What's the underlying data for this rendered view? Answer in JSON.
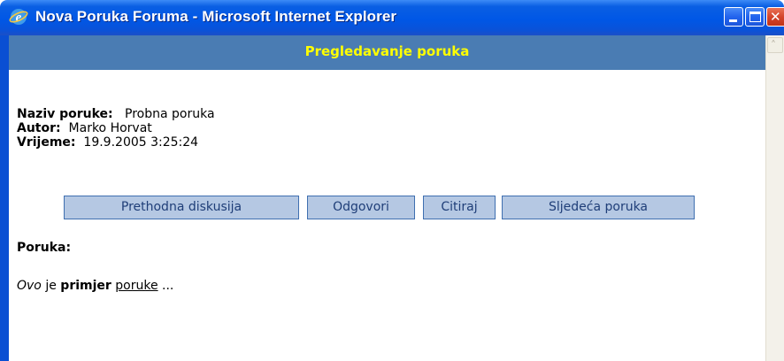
{
  "window": {
    "title": "Nova Poruka Foruma - Microsoft Internet Explorer",
    "title_icon": "ie-icon",
    "controls": {
      "minimize_icon": "minimize-icon",
      "maximize_icon": "maximize-icon",
      "close_icon": "close-icon",
      "close_glyph": "✕"
    }
  },
  "header": {
    "title": "Pregledavanje poruka",
    "background_color": "#4a7cb3",
    "title_color": "#ffff00"
  },
  "meta": {
    "naziv_label": "Naziv poruke:",
    "naziv_value": "Probna poruka",
    "autor_label": "Autor:",
    "autor_value": "Marko Horvat",
    "vrijeme_label": "Vrijeme:",
    "vrijeme_value": "19.9.2005 3:25:24"
  },
  "buttons": {
    "previous": "Prethodna diskusija",
    "reply": "Odgovori",
    "quote": "Citiraj",
    "next": "Sljedeća poruka",
    "background_color": "#b5c8e3",
    "border_color": "#3f6fb0"
  },
  "message": {
    "label": "Poruka:",
    "part_italic": "Ovo",
    "part_plain": "je",
    "part_bold": "primjer",
    "part_underline": "poruke",
    "part_trailing": "..."
  },
  "scrollbar": {
    "up_glyph": "˄",
    "up_icon": "scroll-up-arrow-icon"
  }
}
